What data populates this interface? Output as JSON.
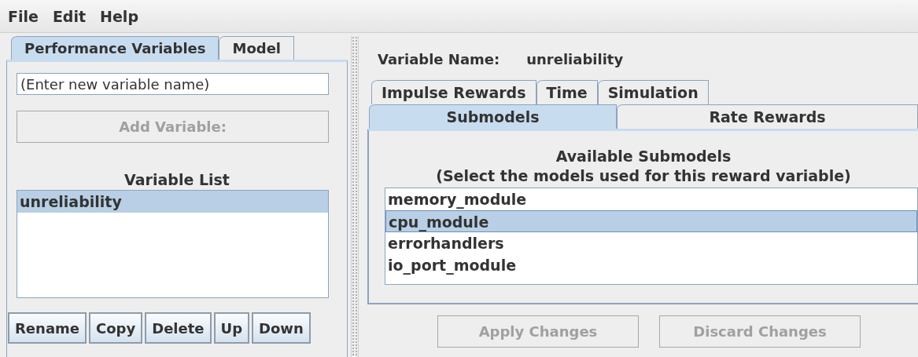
{
  "menu": [
    "File",
    "Edit",
    "Help"
  ],
  "left_tabs": [
    {
      "label": "Performance Variables",
      "selected": true
    },
    {
      "label": "Model",
      "selected": false
    }
  ],
  "new_variable": {
    "placeholder": "(Enter new variable name)"
  },
  "add_button": {
    "label": "Add Variable:",
    "disabled": true
  },
  "variable_list": {
    "title": "Variable List",
    "items": [
      {
        "label": "unreliability",
        "selected": true
      }
    ]
  },
  "list_buttons": [
    "Rename",
    "Copy",
    "Delete",
    "Up",
    "Down"
  ],
  "variable_name": {
    "label": "Variable Name:",
    "value": "unreliability"
  },
  "tab_rows": [
    [
      {
        "label": "Impulse Rewards",
        "selected": false
      },
      {
        "label": "Time",
        "selected": false
      },
      {
        "label": "Simulation",
        "selected": false
      }
    ],
    [
      {
        "label": "Submodels",
        "selected": true
      },
      {
        "label": "Rate Rewards",
        "selected": false
      }
    ]
  ],
  "submodels": {
    "title": "Available Submodels",
    "subtitle": "(Select the models used for this reward variable)",
    "items": [
      {
        "label": "memory_module",
        "selected": false
      },
      {
        "label": "cpu_module",
        "selected": true
      },
      {
        "label": "errorhandlers",
        "selected": false
      },
      {
        "label": "io_port_module",
        "selected": false
      }
    ]
  },
  "actions": [
    {
      "label": "Apply Changes",
      "disabled": true
    },
    {
      "label": "Discard Changes",
      "disabled": true
    }
  ]
}
